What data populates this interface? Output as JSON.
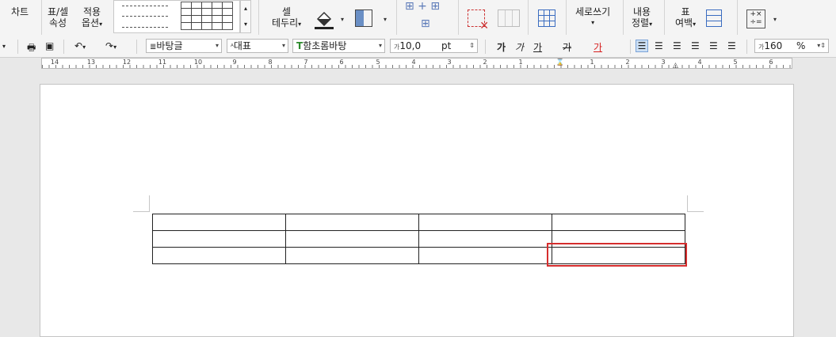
{
  "ribbon": {
    "chart": "차트",
    "table_cell_props_1": "표/셀",
    "table_cell_props_2": "속성",
    "apply_options_1": "적용",
    "apply_options_2": "옵션",
    "cell_border_1": "셀",
    "cell_border_2": "테두리",
    "vertical_write": "세로쓰기",
    "content_align_1": "내용",
    "content_align_2": "정렬",
    "table_margin_1": "표",
    "table_margin_2": "여백"
  },
  "format": {
    "style": "바탕글",
    "lang": "대표",
    "font": "함초롬바탕",
    "size": "10,0",
    "unit": "pt",
    "bold": "가",
    "italic": "가",
    "underline": "가",
    "strike": "가",
    "color": "가",
    "line_spacing": "160",
    "percent": "%"
  },
  "ruler": {
    "labels": [
      "14",
      "13",
      "12",
      "11",
      "10",
      "9",
      "8",
      "7",
      "6",
      "5",
      "4",
      "3",
      "2",
      "1",
      "1",
      "2",
      "3",
      "4",
      "5",
      "6"
    ]
  },
  "document": {
    "table": [
      [
        "",
        "",
        "",
        ""
      ],
      [
        "",
        "",
        "",
        ""
      ],
      [
        "",
        "",
        "",
        ""
      ]
    ],
    "selected_cell": "row-3-col-4"
  }
}
